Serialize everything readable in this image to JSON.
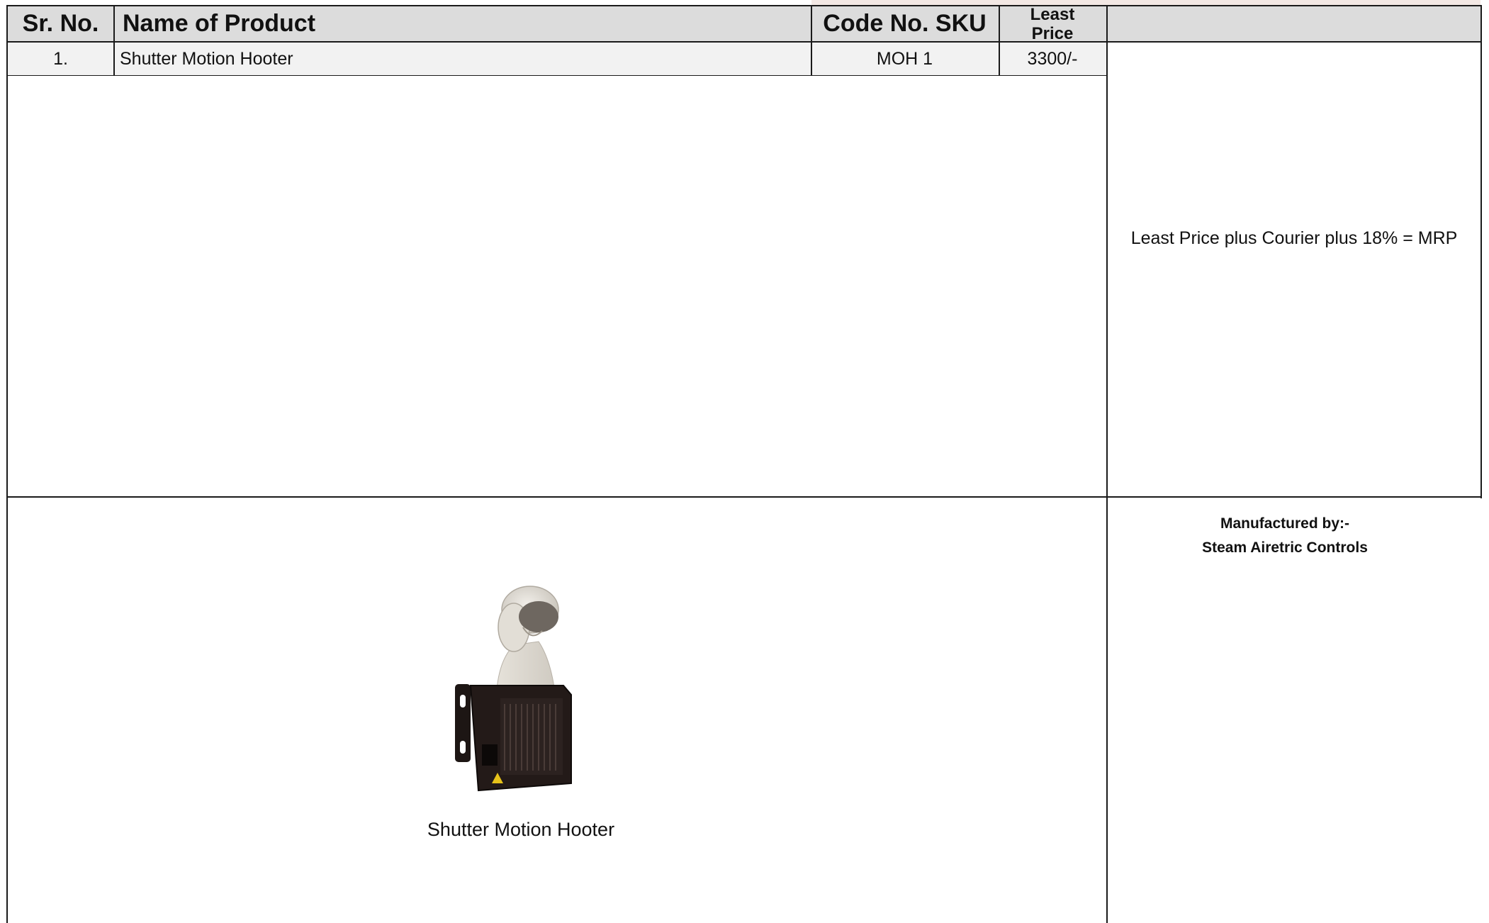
{
  "table": {
    "headers": {
      "sr_no": "Sr. No.",
      "name": "Name of Product",
      "code": "Code No. SKU",
      "price_line1": "Least",
      "price_line2": "Price"
    },
    "rows": [
      {
        "sr_no": "1.",
        "name": "Shutter Motion Hooter",
        "code": "MOH 1",
        "price": "3300/-"
      }
    ]
  },
  "note": "Least Price plus Courier plus 18% = MRP",
  "product_image": {
    "icon": "motion-sensor-hooter-image",
    "caption": "Shutter Motion Hooter"
  },
  "manufacturer": {
    "label": "Manufactured by:-",
    "name": "Steam Airetric Controls"
  }
}
